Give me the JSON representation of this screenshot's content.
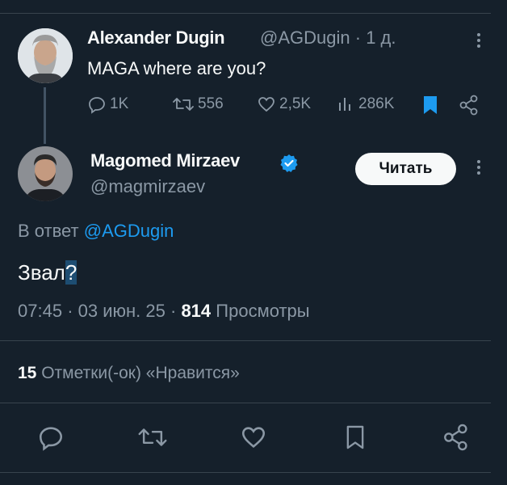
{
  "parent_tweet": {
    "author_name": "Alexander Dugin",
    "handle": "@AGDugin",
    "separator": "·",
    "time_ago": "1 д.",
    "text": "MAGA where are you?",
    "actions": {
      "replies": "1K",
      "retweets": "556",
      "likes": "2,5K",
      "views": "286K"
    },
    "icons": [
      "reply-icon",
      "retweet-icon",
      "like-icon",
      "views-icon",
      "bookmark-filled-icon",
      "share-icon"
    ]
  },
  "reply_tweet": {
    "author_name": "Magomed Mirzaev",
    "handle": "@magmirzaev",
    "verified_color": "#1d9bf0",
    "follow_label": "Читать",
    "reply_prefix": "В ответ",
    "reply_to": "@AGDugin",
    "text_main": "Звал",
    "text_selected": "?",
    "time": "07:45",
    "date": "03 июн. 25",
    "dot": "·",
    "views_count": "814",
    "views_label": "Просмотры",
    "likes_count": "15",
    "likes_label": "Отметки(-ок) «Нравится»"
  },
  "colors": {
    "background": "#15202b",
    "accent": "#1d9bf0",
    "muted": "#8b98a5",
    "text": "#f7f9f9"
  }
}
